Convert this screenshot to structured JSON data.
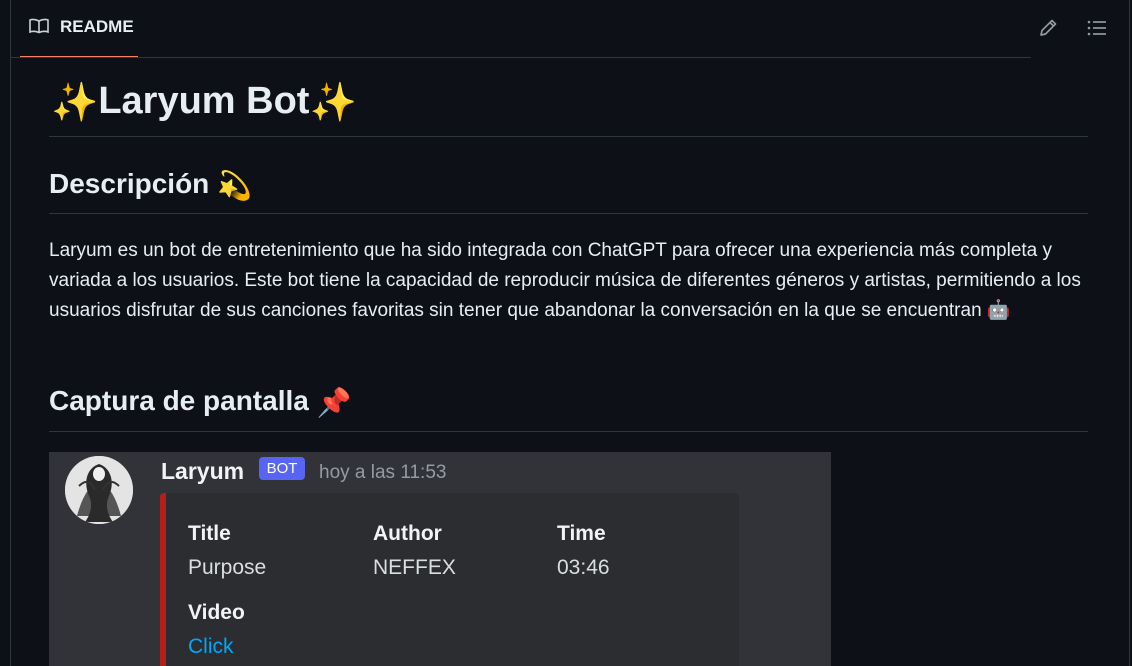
{
  "tabs": {
    "readme_label": "README"
  },
  "icons": {
    "tab": "book-icon",
    "edit": "pencil-icon",
    "toc": "list-icon"
  },
  "colors": {
    "accent": "#f78166",
    "embed_bar": "#b3201b",
    "badge": "#5865f2",
    "link": "#00a8fc"
  },
  "readme": {
    "title": "Laryum Bot",
    "title_emoji": "✨",
    "description_heading": "Descripción",
    "description_emoji": "💫",
    "description_text": "Laryum es un bot de entretenimiento que ha sido integrada con ChatGPT para ofrecer una experiencia más completa y variada a los usuarios. Este bot tiene la capacidad de reproducir música de diferentes géneros y artistas, permitiendo a los usuarios disfrutar de sus canciones favoritas sin tener que abandonar la conversación en la que se encuentran",
    "description_end_emoji": "🤖",
    "screenshot_heading": "Captura de pantalla",
    "screenshot_emoji": "📌"
  },
  "discord": {
    "bot_name": "Laryum",
    "badge": "BOT",
    "timestamp": "hoy a las 11:53",
    "fields": [
      {
        "name": "Title",
        "value": "Purpose"
      },
      {
        "name": "Author",
        "value": "NEFFEX"
      },
      {
        "name": "Time",
        "value": "03:46"
      },
      {
        "name": "Video",
        "value": "Click"
      }
    ]
  }
}
